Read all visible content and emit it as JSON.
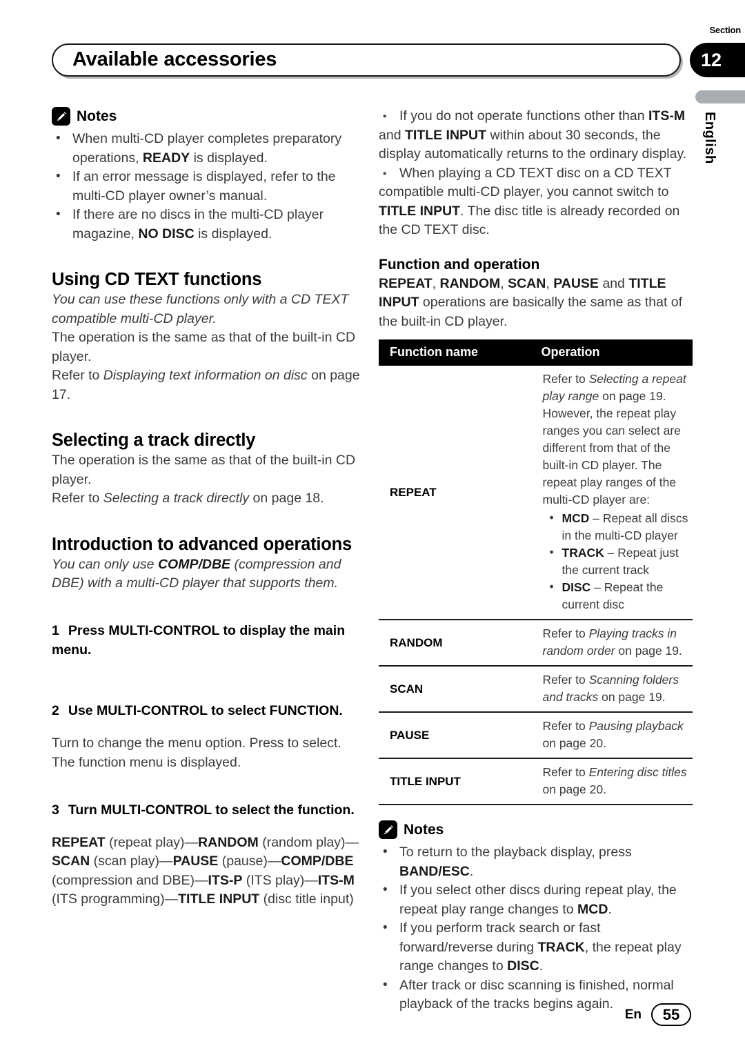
{
  "header": {
    "title": "Available accessories",
    "section_label": "Section",
    "section_number": "12",
    "language_tab": "English"
  },
  "footer": {
    "language": "En",
    "page_number": "55"
  },
  "left_column": {
    "notes": {
      "label": "Notes",
      "items": [
        {
          "parts": [
            {
              "t": "When multi-CD player completes preparatory operations, ",
              "s": "n"
            },
            {
              "t": "READY",
              "s": "b"
            },
            {
              "t": " is displayed.",
              "s": "n"
            }
          ]
        },
        {
          "parts": [
            {
              "t": "If an error message is displayed, refer to the multi-CD player owner’s manual.",
              "s": "n"
            }
          ]
        },
        {
          "parts": [
            {
              "t": "If there are no discs in the multi-CD player magazine, ",
              "s": "n"
            },
            {
              "t": "NO DISC",
              "s": "b"
            },
            {
              "t": " is displayed.",
              "s": "n"
            }
          ]
        }
      ]
    },
    "section_cdtext": {
      "heading": "Using CD TEXT functions",
      "intro_italic": "You can use these functions only with a CD TEXT compatible multi-CD player.",
      "body_1": "The operation is the same as that of the built-in CD player.",
      "refer_prefix": "Refer to ",
      "refer_italic": "Displaying text information on disc",
      "refer_suffix": " on page 17."
    },
    "section_track": {
      "heading": "Selecting a track directly",
      "body_1": "The operation is the same as that of the built-in CD player.",
      "refer_prefix": "Refer to ",
      "refer_italic": "Selecting a track directly",
      "refer_suffix": " on page 18."
    },
    "section_advanced": {
      "heading": "Introduction to advanced operations",
      "intro_parts": [
        {
          "t": "You can only use ",
          "s": "i"
        },
        {
          "t": "COMP/DBE",
          "s": "bi"
        },
        {
          "t": " (compression and DBE) with a multi-CD player that supports them.",
          "s": "i"
        }
      ],
      "steps": [
        {
          "num": "1",
          "text": "Press MULTI-CONTROL to display the main menu."
        },
        {
          "num": "2",
          "text": "Use MULTI-CONTROL to select FUNCTION."
        },
        {
          "num": "3",
          "text": "Turn MULTI-CONTROL to select the function."
        }
      ],
      "step2_body_1": "Turn to change the menu option. Press to select.",
      "step2_body_2": "The function menu is displayed.",
      "step3_sequence": [
        {
          "t": "REPEAT",
          "s": "b"
        },
        {
          "t": " (repeat play)—",
          "s": "n"
        },
        {
          "t": "RANDOM",
          "s": "b"
        },
        {
          "t": " (random play)—",
          "s": "n"
        },
        {
          "t": "SCAN",
          "s": "b"
        },
        {
          "t": " (scan play)—",
          "s": "n"
        },
        {
          "t": "PAUSE",
          "s": "b"
        },
        {
          "t": " (pause)—",
          "s": "n"
        },
        {
          "t": "COMP/DBE",
          "s": "b"
        },
        {
          "t": " (compression and DBE)—",
          "s": "n"
        },
        {
          "t": "ITS-P",
          "s": "b"
        },
        {
          "t": " (ITS play)—",
          "s": "n"
        },
        {
          "t": "ITS-M",
          "s": "b"
        },
        {
          "t": " (ITS programming)—",
          "s": "n"
        },
        {
          "t": "TITLE INPUT",
          "s": "b"
        },
        {
          "t": " (disc title input)",
          "s": "n"
        }
      ]
    }
  },
  "right_column": {
    "top_notes": [
      {
        "parts": [
          {
            "t": "If you do not operate functions other than ",
            "s": "n"
          },
          {
            "t": "ITS-M",
            "s": "b"
          },
          {
            "t": " and ",
            "s": "n"
          },
          {
            "t": "TITLE INPUT",
            "s": "b"
          },
          {
            "t": " within about 30 seconds, the display automatically returns to the ordinary display.",
            "s": "n"
          }
        ]
      },
      {
        "parts": [
          {
            "t": "When playing a CD TEXT disc on a CD TEXT compatible multi-CD player, you cannot switch to ",
            "s": "n"
          },
          {
            "t": "TITLE INPUT",
            "s": "b"
          },
          {
            "t": ". The disc title is already recorded on the CD TEXT disc.",
            "s": "n"
          }
        ]
      }
    ],
    "function_operation": {
      "heading": "Function and operation",
      "intro_parts": [
        {
          "t": "REPEAT",
          "s": "b"
        },
        {
          "t": ", ",
          "s": "n"
        },
        {
          "t": "RANDOM",
          "s": "b"
        },
        {
          "t": ", ",
          "s": "n"
        },
        {
          "t": "SCAN",
          "s": "b"
        },
        {
          "t": ", ",
          "s": "n"
        },
        {
          "t": "PAUSE",
          "s": "b"
        },
        {
          "t": " and ",
          "s": "n"
        },
        {
          "t": "TITLE INPUT",
          "s": "b"
        },
        {
          "t": " operations are basically the same as that of the built-in CD player.",
          "s": "n"
        }
      ],
      "table": {
        "columns": [
          "Function name",
          "Operation"
        ],
        "rows": [
          {
            "name": "REPEAT",
            "operation_parts": [
              {
                "t": "Refer to ",
                "s": "n"
              },
              {
                "t": "Selecting a repeat play range",
                "s": "i"
              },
              {
                "t": " on page 19.",
                "s": "n"
              },
              {
                "t": "\n",
                "s": "br"
              },
              {
                "t": "However, the repeat play ranges you can select are different from that of the built-in CD player. The repeat play ranges of the multi-CD player are:",
                "s": "n"
              }
            ],
            "bullets": [
              [
                {
                  "t": "MCD",
                  "s": "b"
                },
                {
                  "t": " – Repeat all discs in the multi-CD player",
                  "s": "n"
                }
              ],
              [
                {
                  "t": "TRACK",
                  "s": "b"
                },
                {
                  "t": " – Repeat just the current track",
                  "s": "n"
                }
              ],
              [
                {
                  "t": "DISC",
                  "s": "b"
                },
                {
                  "t": " – Repeat the current disc",
                  "s": "n"
                }
              ]
            ]
          },
          {
            "name": "RANDOM",
            "operation_parts": [
              {
                "t": "Refer to ",
                "s": "n"
              },
              {
                "t": "Playing tracks in random order",
                "s": "i"
              },
              {
                "t": " on page 19.",
                "s": "n"
              }
            ],
            "bullets": []
          },
          {
            "name": "SCAN",
            "operation_parts": [
              {
                "t": "Refer to ",
                "s": "n"
              },
              {
                "t": "Scanning folders and tracks",
                "s": "i"
              },
              {
                "t": " on page 19.",
                "s": "n"
              }
            ],
            "bullets": []
          },
          {
            "name": "PAUSE",
            "operation_parts": [
              {
                "t": "Refer to ",
                "s": "n"
              },
              {
                "t": "Pausing playback",
                "s": "i"
              },
              {
                "t": " on page 20.",
                "s": "n"
              }
            ],
            "bullets": []
          },
          {
            "name": "TITLE INPUT",
            "operation_parts": [
              {
                "t": "Refer to ",
                "s": "n"
              },
              {
                "t": "Entering disc titles",
                "s": "i"
              },
              {
                "t": " on page 20.",
                "s": "n"
              }
            ],
            "bullets": []
          }
        ]
      }
    },
    "bottom_notes": {
      "label": "Notes",
      "items": [
        {
          "parts": [
            {
              "t": "To return to the playback display, press ",
              "s": "n"
            },
            {
              "t": "BAND/ESC",
              "s": "b"
            },
            {
              "t": ".",
              "s": "n"
            }
          ]
        },
        {
          "parts": [
            {
              "t": "If you select other discs during repeat play, the repeat play range changes to ",
              "s": "n"
            },
            {
              "t": "MCD",
              "s": "b"
            },
            {
              "t": ".",
              "s": "n"
            }
          ]
        },
        {
          "parts": [
            {
              "t": "If you perform track search or fast forward/reverse during ",
              "s": "n"
            },
            {
              "t": "TRACK",
              "s": "b"
            },
            {
              "t": ", the repeat play range changes to ",
              "s": "n"
            },
            {
              "t": "DISC",
              "s": "b"
            },
            {
              "t": ".",
              "s": "n"
            }
          ]
        },
        {
          "parts": [
            {
              "t": "After track or disc scanning is finished, normal playback of the tracks begins again.",
              "s": "n"
            }
          ]
        }
      ]
    }
  }
}
